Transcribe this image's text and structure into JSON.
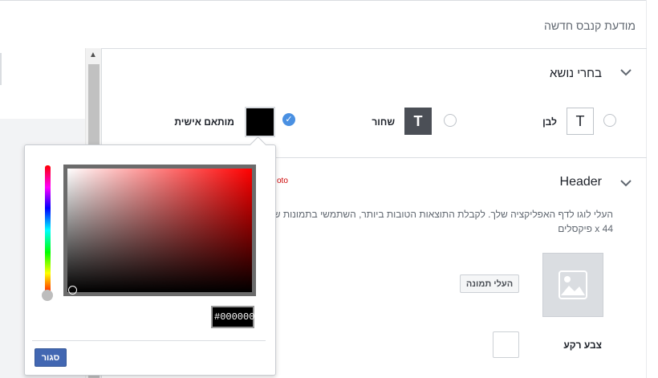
{
  "page": {
    "title": "מודעת קנבס חדשה"
  },
  "theme_section": {
    "title": "בחרי נושא",
    "options": [
      {
        "label": "לבן",
        "glyph": "T",
        "selected": false
      },
      {
        "label": "שחור",
        "glyph": "T",
        "selected": false
      },
      {
        "label": "מותאם אישית",
        "selected": true,
        "color": "#000000"
      }
    ]
  },
  "header_section": {
    "title": "Header",
    "description": "העלי לוגו לדף האפליקציה שלך. לקבלת התוצאות הטובות ביותר, השתמשי בתמונות של",
    "description_line2": "44 x פיקסלים",
    "photo_fragment": "oto",
    "upload_button": "העלי תמונה",
    "background_label": "צבע רקע"
  },
  "color_picker": {
    "hex_value": "#000000",
    "close_button": "סגור"
  },
  "colors": {
    "accent": "#4267b2",
    "check": "#4a90e2"
  }
}
